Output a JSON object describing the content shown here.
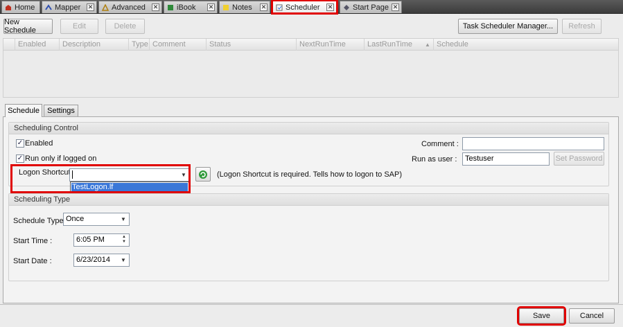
{
  "tabs": [
    {
      "label": "Home",
      "icon": "home-icon"
    },
    {
      "label": "Mapper",
      "icon": "mapper-icon"
    },
    {
      "label": "Advanced",
      "icon": "advanced-icon"
    },
    {
      "label": "iBook",
      "icon": "ibook-icon"
    },
    {
      "label": "Notes",
      "icon": "notes-icon"
    },
    {
      "label": "Scheduler",
      "icon": "scheduler-icon"
    },
    {
      "label": "Start Page",
      "icon": "start-page-icon"
    }
  ],
  "toolbar": {
    "new_schedule": "New Schedule",
    "edit": "Edit",
    "delete": "Delete",
    "task_scheduler_manager": "Task Scheduler Manager...",
    "refresh": "Refresh"
  },
  "grid": {
    "columns": [
      "Enabled",
      "Description",
      "Type",
      "Comment",
      "Status",
      "NextRunTime",
      "LastRunTime",
      "Schedule"
    ],
    "sort_indicator": "▲"
  },
  "subtabs": {
    "schedule": "Schedule",
    "settings": "Settings"
  },
  "scheduling_control": {
    "title": "Scheduling Control",
    "enabled_label": "Enabled",
    "enabled_checked": true,
    "run_only_label": "Run only if logged on",
    "run_only_checked": true,
    "logon_shortcut_label": "Logon Shortcut",
    "logon_shortcut_value": "",
    "logon_shortcut_hint": "(Logon Shortcut is required. Tells how to logon to SAP)",
    "dropdown_option": "TestLogon.lf",
    "comment_label": "Comment :",
    "comment_value": "",
    "run_as_label": "Run as user :",
    "run_as_value": "Testuser",
    "set_password": "Set Password"
  },
  "scheduling_type": {
    "title": "Scheduling Type",
    "schedule_type_label": "Schedule Type:",
    "schedule_type_value": "Once",
    "start_time_label": "Start Time :",
    "start_time_value": "6:05 PM",
    "start_date_label": "Start Date :",
    "start_date_value": "6/23/2014"
  },
  "footer": {
    "save": "Save",
    "cancel": "Cancel"
  },
  "colors": {
    "highlight": "#e00000",
    "selection": "#3a77d8"
  }
}
